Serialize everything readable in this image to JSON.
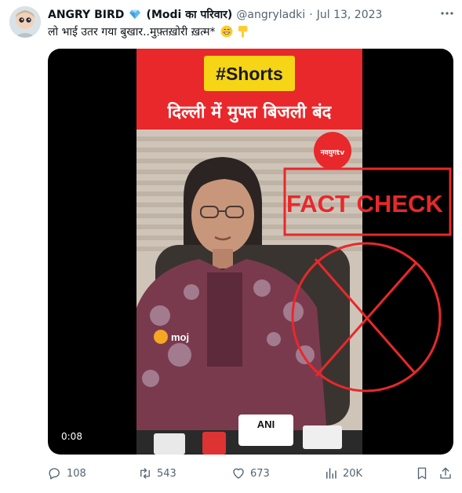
{
  "tweet": {
    "author_name": "ANGRY BIRD",
    "author_badge": "(Modi का परिवार)",
    "handle": "@angryladki",
    "separator": "·",
    "date": "Jul 13, 2023",
    "text": "लो भाई उतर गया बुखार..मुफ़्तख़ोरी ख़त्म*"
  },
  "video": {
    "timestamp": "0:08",
    "shorts_banner": "#Shorts",
    "headline": "दिल्ली में मुफ्त बिजली बंद",
    "channel_logo": "नवयुगtv",
    "fact_check": "FACT CHECK",
    "moj_logo": "moj",
    "mic_label": "ANI"
  },
  "actions": {
    "replies": "108",
    "reposts": "543",
    "likes": "673",
    "views": "20K"
  },
  "icons": [
    "diamond-icon",
    "more-icon",
    "grin-emoji-icon",
    "point-down-emoji-icon",
    "reply-icon",
    "repost-icon",
    "like-icon",
    "views-icon",
    "bookmark-icon",
    "share-icon"
  ],
  "colors": {
    "video_banner": "#e8282b",
    "shorts_yellow": "#f5d516",
    "fact_check_red": "#e8282b",
    "muted_text": "#536471"
  }
}
